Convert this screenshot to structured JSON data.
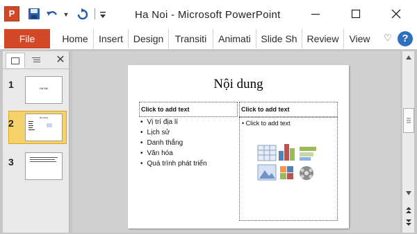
{
  "title_bar": {
    "app_icon_label": "P",
    "title": "Ha Noi  -  Microsoft PowerPoint",
    "icons": [
      "powerpoint-icon",
      "save-icon",
      "undo-icon",
      "redo-icon",
      "customize-qat-icon",
      "minimize-icon",
      "maximize-icon",
      "close-icon"
    ]
  },
  "ribbon": {
    "file_label": "File",
    "tabs": [
      "Home",
      "Insert",
      "Design",
      "Transiti",
      "Animati",
      "Slide Sh",
      "Review",
      "View"
    ],
    "help_label": "?"
  },
  "thumbnails": [
    {
      "number": "1",
      "title": "Hà Nội"
    },
    {
      "number": "2",
      "title": "Nội dung"
    },
    {
      "number": "3",
      "title": ""
    }
  ],
  "slide": {
    "title": "Nội dung",
    "left_header": "Click to add text",
    "right_header": "Click to add text",
    "right_body": "Click to add text",
    "bullets": [
      "Vị trí địa lí",
      "Lịch sử",
      "Danh thắng",
      "Văn hóa",
      "Quá trình phát triển"
    ]
  },
  "colors": {
    "accent": "#d24726",
    "selected_thumb": "#f6d36a",
    "help": "#2e6fc2"
  }
}
